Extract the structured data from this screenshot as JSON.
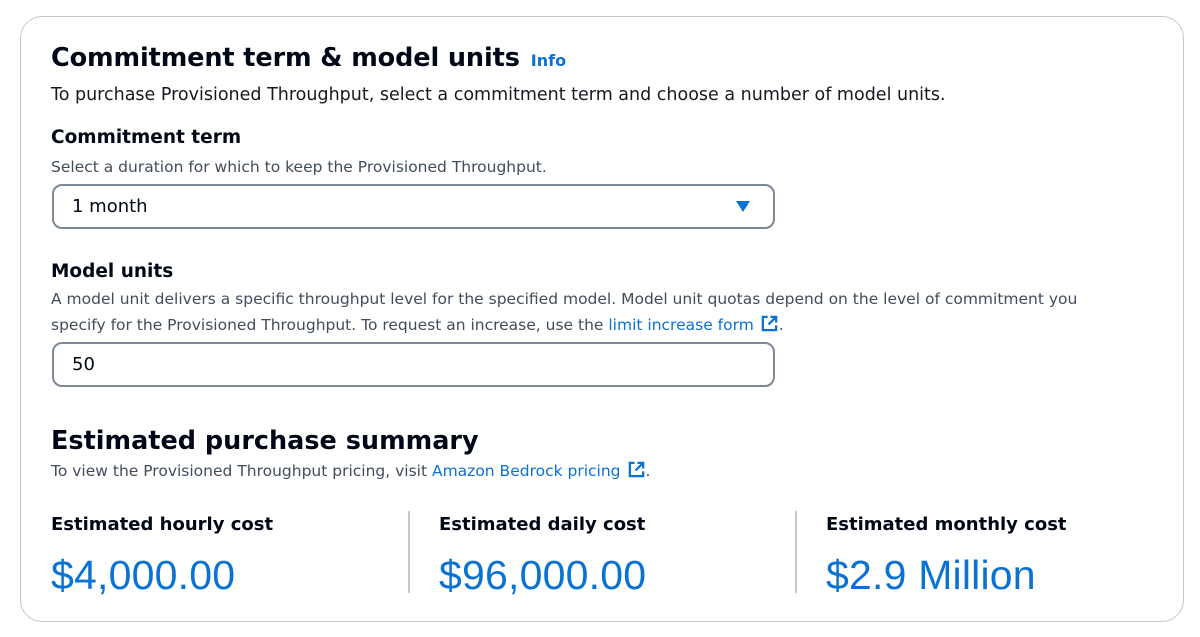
{
  "section": {
    "title": "Commitment term & model units",
    "info_label": "Info",
    "description": "To purchase Provisioned Throughput, select a commitment term and choose a number of model units."
  },
  "commitment_term": {
    "label": "Commitment term",
    "description": "Select a duration for which to keep the Provisioned Throughput.",
    "selected": "1 month",
    "icon": "caret-down-icon"
  },
  "model_units": {
    "label": "Model units",
    "description_line1": "A model unit delivers a specific throughput level for the specified model. Model unit quotas depend on the level of commitment you",
    "description_line2_prefix": "specify for the Provisioned Throughput. To request an increase, use the ",
    "link_label": "limit increase form",
    "description_line2_suffix": ".",
    "value": "50"
  },
  "summary": {
    "title": "Estimated purchase summary",
    "description_prefix": "To view the Provisioned Throughput pricing, visit ",
    "link_label": "Amazon Bedrock pricing",
    "description_suffix": ".",
    "costs": [
      {
        "label": "Estimated hourly cost",
        "value": "$4,000.00"
      },
      {
        "label": "Estimated daily cost",
        "value": "$96,000.00"
      },
      {
        "label": "Estimated monthly cost",
        "value": "$2.9 Million"
      }
    ]
  },
  "colors": {
    "link": "#0972d3",
    "text": "#000716",
    "secondary_text": "#414d5c",
    "input_border": "#7d8998",
    "panel_border": "#c6c6cd"
  }
}
